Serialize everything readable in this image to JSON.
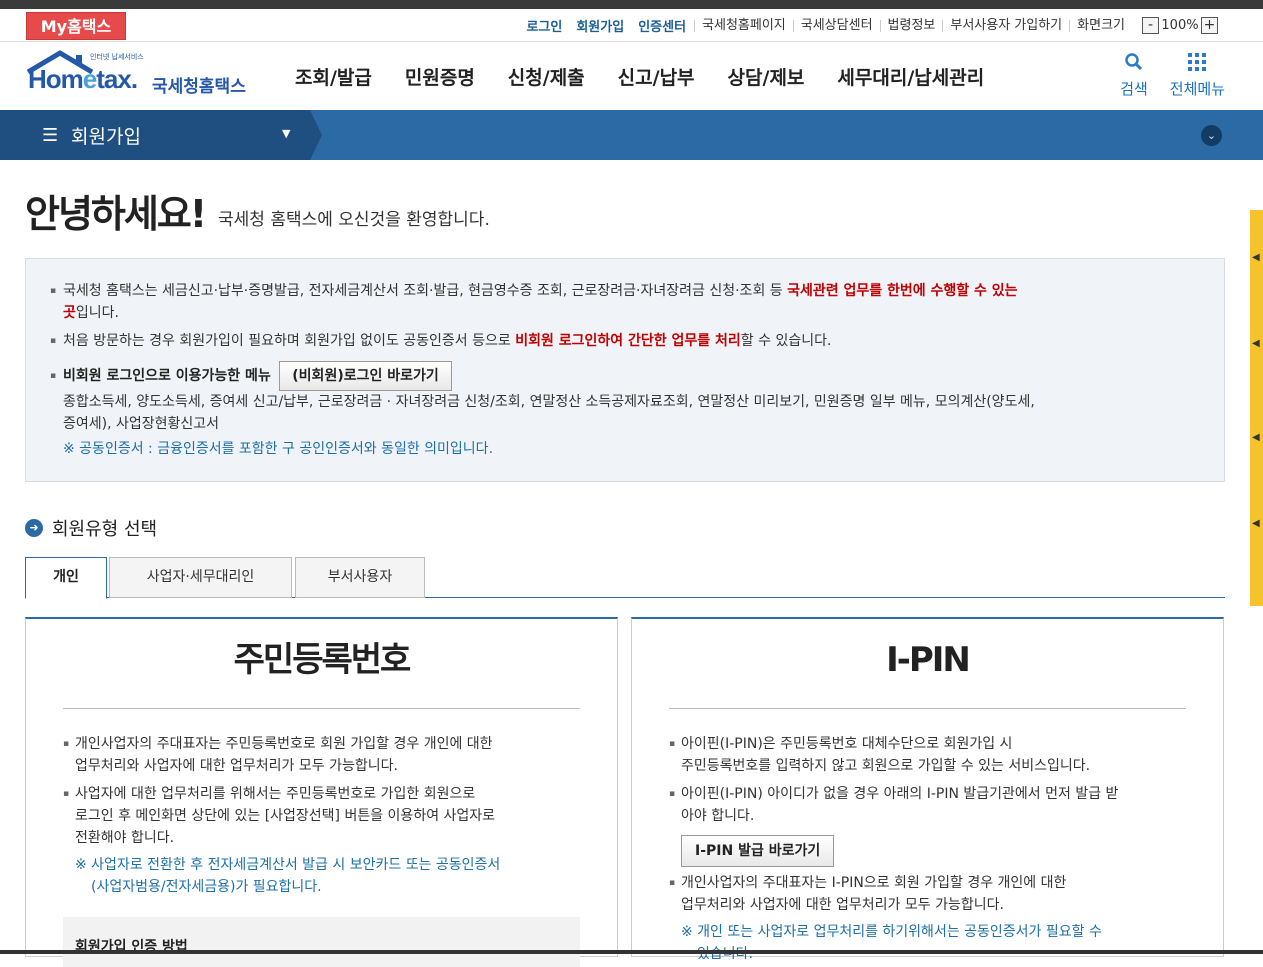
{
  "topbar": {
    "my_hometax": "My홈택스",
    "links_primary": [
      "로그인",
      "회원가입",
      "인증센터"
    ],
    "links_secondary": [
      "국세청홈페이지",
      "국세상담센터",
      "법령정보",
      "부서사용자 가입하기",
      "화면크기"
    ],
    "zoom": "100%",
    "zoom_minus": "-",
    "zoom_plus": "+"
  },
  "logo": {
    "subtitle": "인터넷 납세서비스",
    "name_a": "Hom",
    "name_e": "e",
    "name_b": "tax.",
    "korean": "국세청홈택스"
  },
  "nav": [
    "조회/발급",
    "민원증명",
    "신청/제출",
    "신고/납부",
    "상담/제보",
    "세무대리/납세관리"
  ],
  "header_icons": {
    "search": "검색",
    "menu": "전체메뉴"
  },
  "breadcrumb": {
    "title": "회원가입"
  },
  "greeting": {
    "title": "안녕하세요!",
    "subtitle": "국세청 홈택스에 오신것을 환영합니다."
  },
  "info": {
    "line1_a": "국세청 홈택스는 세금신고·납부·증명발급, 전자세금계산서 조회·발급, 현금영수증 조회, 근로장려금·자녀장려금 신청·조회 등 ",
    "line1_red": "국세관련 업무를 한번에 수행할 수 있는",
    "line1_red2": "곳",
    "line1_b": "입니다.",
    "line2_a": "처음 방문하는 경우 회원가입이 필요하며 회원가입 없이도 공동인증서 등으로 ",
    "line2_red": "비회원 로그인하여 간단한 업무를 처리",
    "line2_b": "할 수 있습니다.",
    "line3_label": "비회원 로그인으로 이용가능한 메뉴",
    "line3_button": "(비회원)로그인 바로가기",
    "line4": "종합소득세, 양도소득세, 증여세 신고/납부, 근로장려금 · 자녀장려금 신청/조회, 연말정산 소득공제자료조회, 연말정산 미리보기, 민원증명 일부 메뉴, 모의계산(양도세,",
    "line5": "증여세), 사업장현황신고서",
    "note": "※ 공동인증서 : 금융인증서를 포함한 구 공인인증서와 동일한 의미입니다."
  },
  "section": {
    "title": "회원유형 선택"
  },
  "tabs": [
    "개인",
    "사업자·세무대리인",
    "부서사용자"
  ],
  "card_left": {
    "title": "주민등록번호",
    "b1_l1": "개인사업자의 주대표자는 주민등록번호로 회원 가입할 경우 개인에 대한",
    "b1_l2": "업무처리와 사업자에 대한 업무처리가 모두 가능합니다.",
    "b2_l1": "사업자에 대한 업무처리를 위해서는 주민등록번호로 가입한 회원으로",
    "b2_l2": "로그인 후 메인화면 상단에 있는 [사업장선택] 버튼을 이용하여 사업자로",
    "b2_l3": "전환해야 합니다.",
    "note_l1": "※ 사업자로 전환한 후 전자세금계산서 발급 시 보안카드 또는 공동인증서",
    "note_l2": "(사업자범용/전자세금용)가 필요합니다.",
    "auth_title": "회원가입 인증 방법"
  },
  "card_right": {
    "title": "I-PIN",
    "b1_l1": "아이핀(I-PIN)은 주민등록번호 대체수단으로 회원가입 시",
    "b1_l2": "주민등록번호를 입력하지 않고 회원으로 가입할 수 있는 서비스입니다.",
    "b2_l1": "아이핀(I-PIN) 아이디가 없을 경우 아래의 I-PIN 발급기관에서 먼저 발급 받",
    "b2_l2": "아야 합니다.",
    "button": "I-PIN 발급 바로가기",
    "b3_l1": "개인사업자의 주대표자는 I-PIN으로 회원 가입할 경우 개인에 대한",
    "b3_l2": "업무처리와 사업자에 대한 업무처리가 모두 가능합니다.",
    "note_l1": "※ 개인 또는 사업자로 업무처리를 하기위해서는 공동인증서가 필요할 수",
    "note_l2": "있습니다."
  },
  "colors": {
    "brand_blue": "#2c6aa5",
    "dark_blue": "#1f4f80",
    "emphasis_red": "#c00000",
    "my_hometax_red": "#e74a4a",
    "side_tab_yellow": "#f5c32c"
  }
}
